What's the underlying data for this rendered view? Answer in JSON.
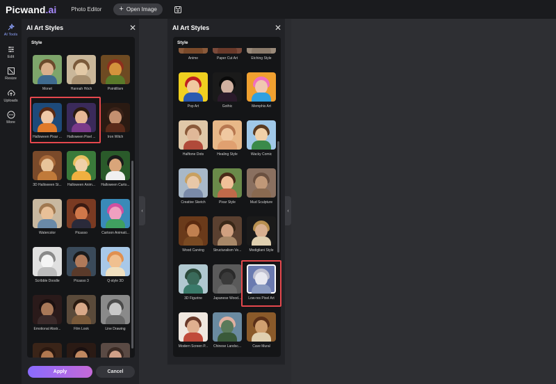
{
  "app": {
    "logo_main": "Picwand",
    "logo_suffix": ".ai",
    "editor_label": "Photo Editor",
    "open_image_label": "Open Image"
  },
  "rail": {
    "items": [
      {
        "label": "AI Tools",
        "icon": "ai-tools-icon"
      },
      {
        "label": "Edit",
        "icon": "sliders-icon"
      },
      {
        "label": "Resize",
        "icon": "resize-icon"
      },
      {
        "label": "Uploads",
        "icon": "upload-icon"
      },
      {
        "label": "More",
        "icon": "more-icon"
      }
    ]
  },
  "left_panel": {
    "title": "AI Art Styles",
    "style_label": "Style",
    "apply_label": "Apply",
    "cancel_label": "Cancel",
    "tiles": [
      {
        "label": "Monet",
        "bg": "#7ea56b",
        "face": "#d9b08c",
        "hair": "#6b4a2b",
        "body": "#3f6b8f"
      },
      {
        "label": "Hannah Höch",
        "bg": "#c9b79a",
        "face": "#e2c9a6",
        "hair": "#7a5a3a",
        "body": "#a89070"
      },
      {
        "label": "Pointillism",
        "bg": "#6e4a22",
        "face": "#d4933c",
        "hair": "#8e2f1c",
        "body": "#5a7a2a"
      },
      {
        "label": "Halloween Pixar ...",
        "bg": "#1d4a7a",
        "face": "#f0c9a8",
        "hair": "#5a2a14",
        "body": "#e07a2a"
      },
      {
        "label": "Halloween Pixel ...",
        "bg": "#3a2a5a",
        "face": "#e8b896",
        "hair": "#2a1a10",
        "body": "#7a3a8a"
      },
      {
        "label": "Iron Witch",
        "bg": "#2a1a12",
        "face": "#c49070",
        "hair": "#3a2218",
        "body": "#5a2a1a"
      },
      {
        "label": "3D Halloween St...",
        "bg": "#7a4a2a",
        "face": "#e8c49a",
        "hair": "#a86a3a",
        "body": "#c07a3a"
      },
      {
        "label": "Halloween Anim...",
        "bg": "#3a7a3a",
        "face": "#f0d0a8",
        "hair": "#e8c060",
        "body": "#f0b040"
      },
      {
        "label": "Halloween Carto...",
        "bg": "#2a5a2a",
        "face": "#d9a57a",
        "hair": "#1a1a1a",
        "body": "#f0f0f0"
      },
      {
        "label": "Watercolor",
        "bg": "#c8b8a0",
        "face": "#e8c098",
        "hair": "#a07850",
        "body": "#6a8aa8"
      },
      {
        "label": "Picasso",
        "bg": "#7a3a22",
        "face": "#d0784a",
        "hair": "#3a1a12",
        "body": "#2a2a3a"
      },
      {
        "label": "Cartoon Animati...",
        "bg": "#3a8ab8",
        "face": "#f0a0c0",
        "hair": "#d050a0",
        "body": "#40a060"
      },
      {
        "label": "Scribble Doodle",
        "bg": "#e0e0e0",
        "face": "#f4f4f4",
        "hair": "#8a8a8a",
        "body": "#bcbcbc"
      },
      {
        "label": "Picasso 3",
        "bg": "#3a4a5a",
        "face": "#b07a5a",
        "hair": "#1a1a1a",
        "body": "#5a3a2a"
      },
      {
        "label": "Q-style 3D",
        "bg": "#a8c8e8",
        "face": "#f0c090",
        "hair": "#e09050",
        "body": "#f0e0c0"
      },
      {
        "label": "Emotional Abstr...",
        "bg": "#2a1a1a",
        "face": "#a87858",
        "hair": "#1a1010",
        "body": "#3a2a2a"
      },
      {
        "label": "Film Look",
        "bg": "#5a4a3a",
        "face": "#d8a888",
        "hair": "#2a1a10",
        "body": "#7a5a3a"
      },
      {
        "label": "Line Drawing",
        "bg": "#8a8a8a",
        "face": "#c8c8c8",
        "hair": "#4a4a4a",
        "body": "#6a6a6a"
      },
      {
        "label": "",
        "bg": "#3a2418",
        "face": "#b07850",
        "hair": "#2a1810",
        "body": "#4a3020"
      },
      {
        "label": "",
        "bg": "#2a1a14",
        "face": "#c08860",
        "hair": "#1a1010",
        "body": "#3a2418"
      },
      {
        "label": "",
        "bg": "#5a4a44",
        "face": "#d0a088",
        "hair": "#3a2a24",
        "body": "#5a4a44"
      }
    ]
  },
  "right_panel": {
    "title": "AI Art Styles",
    "style_label": "Style",
    "tiles": [
      {
        "label": "Anime",
        "bg": "#8a5a3a",
        "face": "#e0b090",
        "hair": "#5a3020",
        "body": "#7a4a2a"
      },
      {
        "label": "Paper Cut Art",
        "bg": "#7a4a3a",
        "face": "#d09878",
        "hair": "#4a2a1a",
        "body": "#6a3a2a"
      },
      {
        "label": "Etching Style",
        "bg": "#9a8a7a",
        "face": "#c8b8a0",
        "hair": "#5a4a3a",
        "body": "#8a7a6a"
      },
      {
        "label": "Pop Art",
        "bg": "#f0d020",
        "face": "#f0c8a0",
        "hair": "#c02020",
        "body": "#2a5ab0"
      },
      {
        "label": "Gothic",
        "bg": "#1a1a1a",
        "face": "#d0b0a0",
        "hair": "#0a0a0a",
        "body": "#2a1a2a"
      },
      {
        "label": "Memphis Art",
        "bg": "#f0a030",
        "face": "#f0c8b0",
        "hair": "#f070c0",
        "body": "#30a0e0"
      },
      {
        "label": "Halftone Dots",
        "bg": "#e0c8a8",
        "face": "#e0b898",
        "hair": "#8a5a3a",
        "body": "#b04a3a"
      },
      {
        "label": "Healing Style",
        "bg": "#e8b888",
        "face": "#f0c8a0",
        "hair": "#b87850",
        "body": "#e0a070"
      },
      {
        "label": "Wacky Comic",
        "bg": "#a0c8e8",
        "face": "#f0d0a8",
        "hair": "#5a3a20",
        "body": "#3a8a4a"
      },
      {
        "label": "Creative Sketch",
        "bg": "#a8b8c8",
        "face": "#e8c8a8",
        "hair": "#c8a060",
        "body": "#7a8aa8"
      },
      {
        "label": "Pixar Style",
        "bg": "#6a8a4a",
        "face": "#f0c098",
        "hair": "#4a2a18",
        "body": "#c06a4a"
      },
      {
        "label": "Mud Sculpture",
        "bg": "#8a7060",
        "face": "#c09878",
        "hair": "#6a5040",
        "body": "#8a6a50"
      },
      {
        "label": "Wood Carving",
        "bg": "#6a3a1a",
        "face": "#c08050",
        "hair": "#5a2a10",
        "body": "#7a4a22"
      },
      {
        "label": "Structuralism Ve...",
        "bg": "#5a4030",
        "face": "#d0a080",
        "hair": "#3a2818",
        "body": "#a88868"
      },
      {
        "label": "Modigliani Style",
        "bg": "#1a1a1a",
        "face": "#d8b090",
        "hair": "#b89050",
        "body": "#e0d0b0"
      },
      {
        "label": "3D Figurine",
        "bg": "#b0c8d0",
        "face": "#3a6a5a",
        "hair": "#2a4a3a",
        "body": "#3a7a6a"
      },
      {
        "label": "Japanese Wood...",
        "bg": "#5a5a5a",
        "face": "#3a3a3a",
        "hair": "#2a2a2a",
        "body": "#6a6a6a"
      },
      {
        "label": "Low-res Pixel Art",
        "bg": "#6a7ab0",
        "face": "#e8e8f0",
        "hair": "#c0c0d0",
        "body": "#8a9ac0"
      },
      {
        "label": "Modern Screen P...",
        "bg": "#f0e8e0",
        "face": "#e0b090",
        "hair": "#6a3a2a",
        "body": "#c04a3a"
      },
      {
        "label": "Chinese Landsc...",
        "bg": "#6a8aa0",
        "face": "#5a7a5a",
        "hair": "#e0b0a0",
        "body": "#3a5a3a"
      },
      {
        "label": "Cave Mural",
        "bg": "#8a5a2a",
        "face": "#d0a070",
        "hair": "#5a3018",
        "body": "#e0d0b0"
      }
    ]
  }
}
